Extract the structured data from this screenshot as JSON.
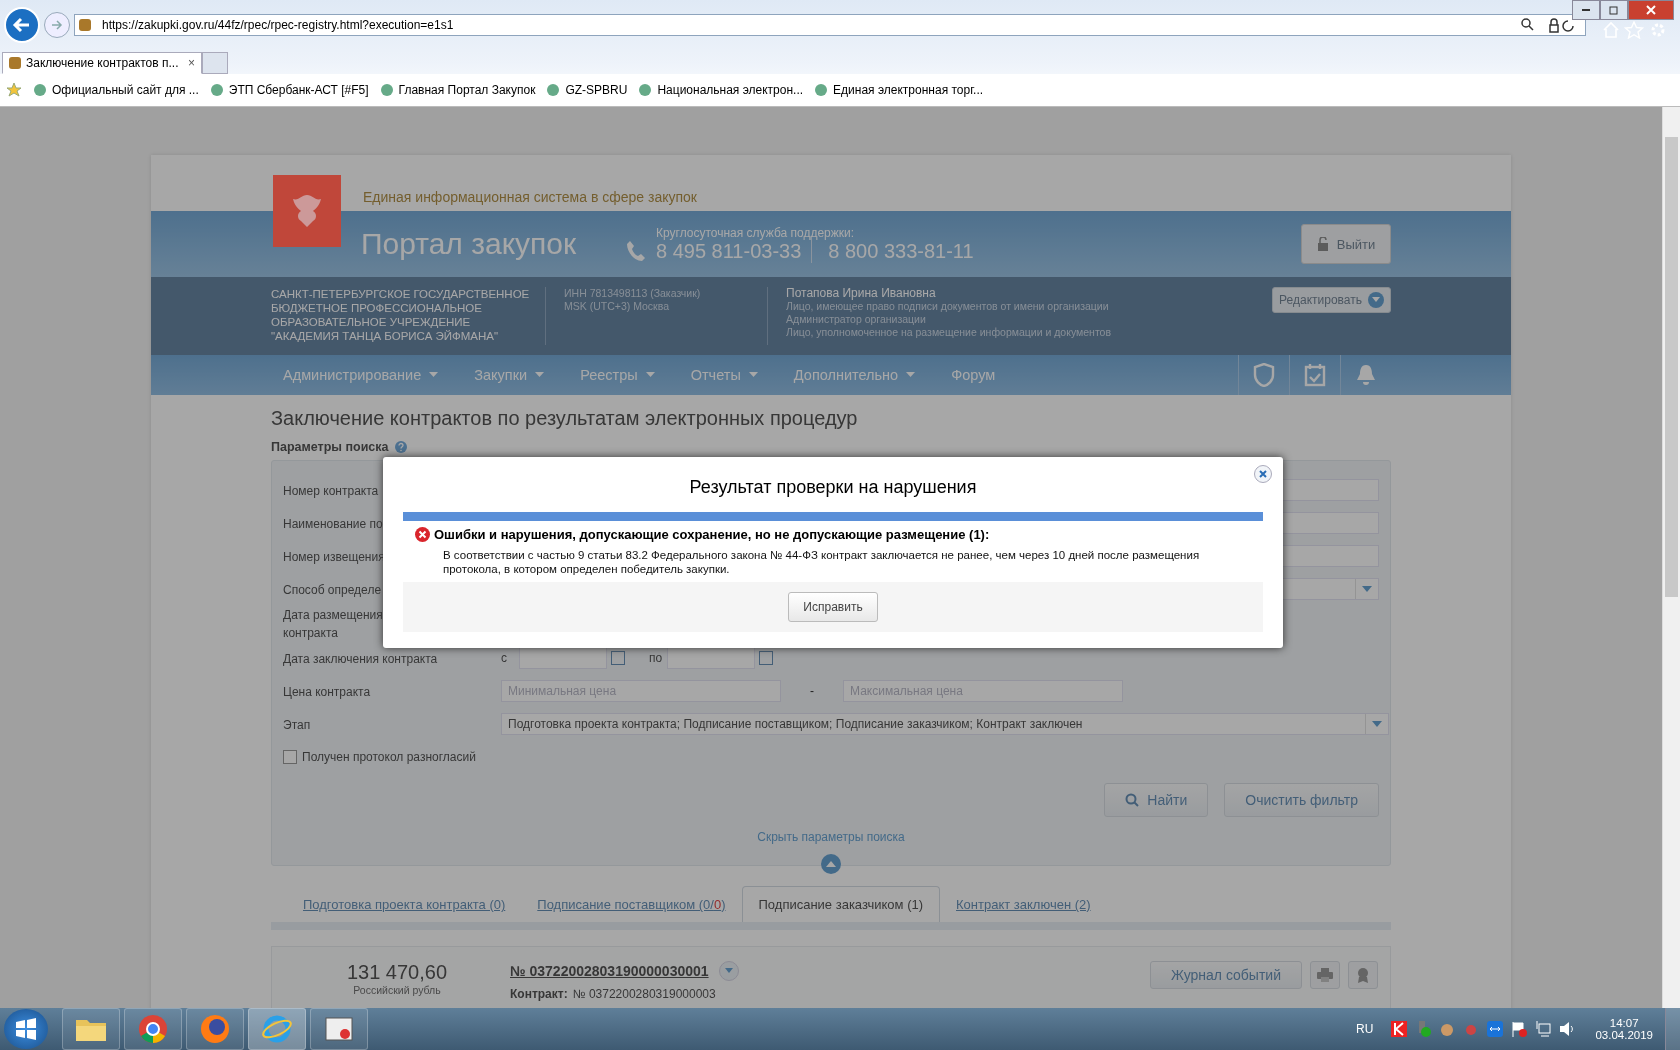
{
  "browser": {
    "url": "https://zakupki.gov.ru/44fz/rpec/rpec-registry.html?execution=e1s1",
    "tabs": [
      {
        "title": "Заключение контрактов п...",
        "close": "×",
        "selected": true
      }
    ],
    "favorites": [
      "Официальный сайт для ...",
      "ЭТП Сбербанк-АСТ [#F5]",
      "Главная Портал Закупок",
      "GZ-SPBRU",
      "Национальная электрон...",
      "Единая электронная торг..."
    ]
  },
  "header": {
    "subtitle": "Единая информационная система в сфере закупок",
    "title": "Портал закупок",
    "support_label": "Круглосуточная служба поддержки:",
    "phones": [
      "8 495 811-03-33",
      "8 800 333-81-11"
    ],
    "logout": "Выйти"
  },
  "org": {
    "name": "САНКТ-ПЕТЕРБУРГСКОЕ ГОСУДАРСТВЕННОЕ БЮДЖЕТНОЕ ПРОФЕССИОНАЛЬНОЕ ОБРАЗОВАТЕЛЬНОЕ УЧРЕЖДЕНИЕ \"АКАДЕМИЯ ТАНЦА БОРИСА ЭЙФМАНА\"",
    "inn": "ИНН 7813498113 (Заказчик)",
    "timezone": "MSK (UTC+3) Москва",
    "user": "Потапова Ирина Ивановна",
    "roles": [
      "Лицо, имеющее право подписи документов от имени организации",
      "Администратор организации",
      "Лицо, уполномоченное на размещение информации и документов"
    ],
    "edit": "Редактировать"
  },
  "nav": [
    {
      "label": "Администрирование",
      "dropdown": true
    },
    {
      "label": "Закупки",
      "dropdown": true
    },
    {
      "label": "Реестры",
      "dropdown": true
    },
    {
      "label": "Отчеты",
      "dropdown": true
    },
    {
      "label": "Дополнительно",
      "dropdown": true
    },
    {
      "label": "Форум",
      "dropdown": false
    }
  ],
  "page_title": "Заключение контрактов по результатам электронных процедур",
  "search_params": "Параметры поиска",
  "form": [
    {
      "label": "Номер контракта",
      "kind": "text"
    },
    {
      "label": "Наименование по",
      "kind": "text"
    },
    {
      "label": "Номер извещения",
      "kind": "text"
    },
    {
      "label": "Способ определе",
      "kind": "select"
    },
    {
      "label": "Дата размещения контракта",
      "kind": "blank"
    },
    {
      "label": "Дата заключения контракта",
      "kind": "dates",
      "from": "с",
      "to": "по"
    },
    {
      "label": "Цена контракта",
      "kind": "range",
      "min_placeholder": "Минимальная цена",
      "sep": "-",
      "max_placeholder": "Максимальная цена"
    },
    {
      "label": "Этап",
      "kind": "select",
      "value": "Подготовка проекта контракта; Подписание поставщиком; Подписание заказчиком; Контракт заключен"
    }
  ],
  "checkbox": {
    "label": "Получен протокол разногласий",
    "checked": false
  },
  "find": "Найти",
  "clear": "Очистить фильтр",
  "hide_params": "Скрыть параметры поиска",
  "tabs": [
    {
      "parts": [
        {
          "text": "Подготовка проекта контракта (0)",
          "alert": false
        }
      ],
      "selected": false
    },
    {
      "parts": [
        {
          "text": "Подписание поставщиком (0/",
          "alert": false
        },
        {
          "text": "0",
          "alert": true
        },
        {
          "text": ")",
          "alert": false
        }
      ],
      "selected": false
    },
    {
      "parts": [
        {
          "text": "Подписание заказчиком (1)",
          "alert": false
        }
      ],
      "selected": true
    },
    {
      "parts": [
        {
          "text": "Контракт заключен (2)",
          "alert": false
        }
      ],
      "selected": false
    }
  ],
  "record": {
    "price": "131 470,60",
    "currency": "Российский рубль",
    "number": "№ 03722002803190000030001",
    "contract_label": "Контракт:",
    "contract": "№ 0372200280319000003",
    "journal": "Журнал событий"
  },
  "dialog": {
    "title": "Результат проверки на нарушения",
    "section": "Ошибки и нарушения, допускающие сохранение, но не допускающие размещение (1):",
    "message": "В соответствии с частью 9 статьи 83.2 Федерального закона № 44-ФЗ контракт заключается не ранее, чем через 10 дней после размещения протокола, в котором определен победитель закупки.",
    "button": "Исправить"
  },
  "taskbar": {
    "lang": "RU",
    "time": "14:07",
    "date": "03.04.2019"
  }
}
